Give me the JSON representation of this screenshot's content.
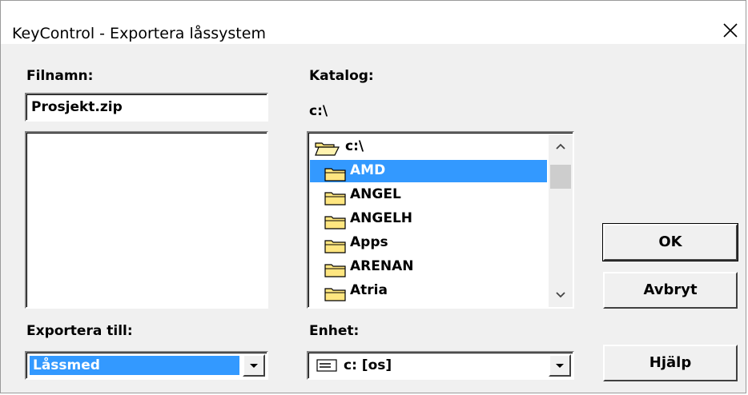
{
  "window": {
    "title": "KeyControl - Exportera låssystem"
  },
  "left": {
    "filename_label": "Filnamn:",
    "filename_value": "Prosjekt.zip",
    "export_label": "Exportera till:",
    "export_value": "Låssmed"
  },
  "middle": {
    "directory_label": "Katalog:",
    "current_path": "c:\\",
    "tree_root": "c:\\",
    "folders": [
      {
        "name": "AMD",
        "selected": true
      },
      {
        "name": "ANGEL",
        "selected": false
      },
      {
        "name": "ANGELH",
        "selected": false
      },
      {
        "name": "Apps",
        "selected": false
      },
      {
        "name": "ARENAN",
        "selected": false
      },
      {
        "name": "Atria",
        "selected": false
      }
    ],
    "drive_label": "Enhet:",
    "drive_value": "c: [os]"
  },
  "buttons": {
    "ok": "OK",
    "cancel": "Avbryt",
    "help": "Hjälp"
  },
  "colors": {
    "selection": "#3399ff",
    "folder": "#ffe680"
  },
  "icons": {
    "close": "close-icon",
    "open_folder": "open-folder-icon",
    "folder": "folder-icon",
    "drive": "drive-icon"
  }
}
